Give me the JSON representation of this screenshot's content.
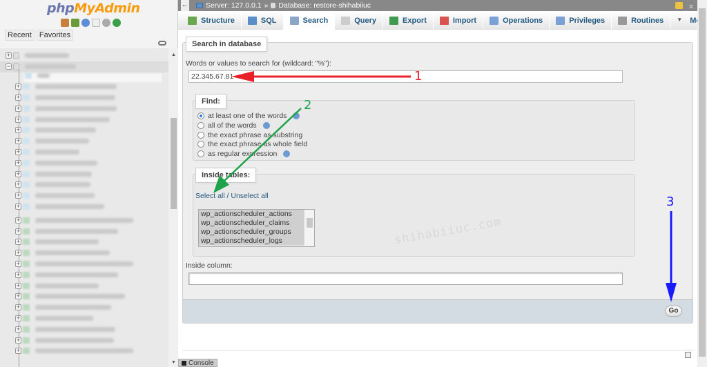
{
  "sidebar": {
    "logo": {
      "part1": "php",
      "part2": "MyAdmin"
    },
    "nav_icons": [
      "home-icon",
      "logout-icon",
      "help-icon",
      "docs-icon",
      "settings-icon",
      "reload-icon"
    ],
    "recent_label": "Recent",
    "favorites_label": "Favorites",
    "tree_note": "Database and table names in the navigation tree are blurred"
  },
  "topbar": {
    "server_label": "Server: 127.0.0.1",
    "separator": "»",
    "database_label": "Database: restore-shihabiiuc"
  },
  "tabs": [
    {
      "label": "Structure",
      "icon": "structure-icon",
      "color": "#6aa84f"
    },
    {
      "label": "SQL",
      "icon": "sql-icon",
      "color": "#5b8dc9"
    },
    {
      "label": "Search",
      "icon": "search-icon",
      "color": "#8aa7c7",
      "active": true
    },
    {
      "label": "Query",
      "icon": "query-icon",
      "color": "#cccccc"
    },
    {
      "label": "Export",
      "icon": "export-icon",
      "color": "#3f9a4f"
    },
    {
      "label": "Import",
      "icon": "import-icon",
      "color": "#d9534f"
    },
    {
      "label": "Operations",
      "icon": "wrench-icon",
      "color": "#7aa0d4"
    },
    {
      "label": "Privileges",
      "icon": "privileges-icon",
      "color": "#7aa0d4"
    },
    {
      "label": "Routines",
      "icon": "routines-icon",
      "color": "#999999"
    },
    {
      "label": "More",
      "icon": "caret-down-icon",
      "color": "#555555"
    }
  ],
  "form": {
    "legend": "Search in database",
    "words_label": "Words or values to search for (wildcard: \"%\"):",
    "words_value": "22.345.67.81",
    "find": {
      "legend": "Find:",
      "options": [
        {
          "label": "at least one of the words",
          "checked": true,
          "help": true
        },
        {
          "label": "all of the words",
          "checked": false,
          "help": true
        },
        {
          "label": "the exact phrase as substring",
          "checked": false,
          "help": false
        },
        {
          "label": "the exact phrase as whole field",
          "checked": false,
          "help": false
        },
        {
          "label": "as regular expression",
          "checked": false,
          "help": true
        }
      ]
    },
    "tables": {
      "legend": "Inside tables:",
      "select_all": "Select all",
      "link_sep": " / ",
      "unselect_all": "Unselect all",
      "items": [
        "wp_actionscheduler_actions",
        "wp_actionscheduler_claims",
        "wp_actionscheduler_groups",
        "wp_actionscheduler_logs"
      ]
    },
    "column_label": "Inside column:",
    "column_value": "",
    "go_label": "Go"
  },
  "console_label": "Console",
  "watermark": "shihabiiuc.com",
  "annotations": {
    "step1": "1",
    "step2": "2",
    "step3": "3",
    "colors": {
      "step1": "#e8202a",
      "step2": "#1fa34a",
      "step3": "#1a1aff"
    }
  }
}
